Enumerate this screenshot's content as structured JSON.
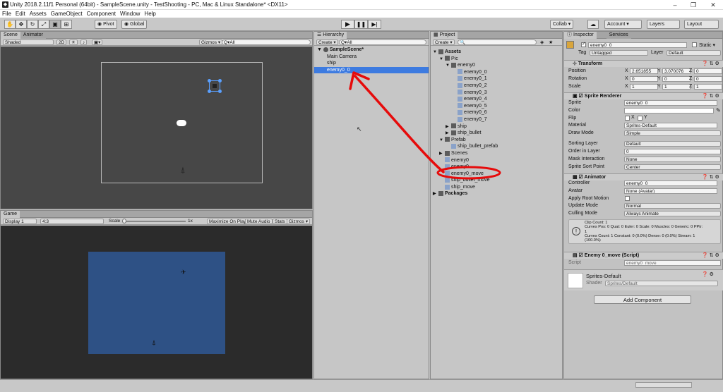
{
  "window": {
    "title": "Unity 2018.2.11f1 Personal (64bit) - SampleScene.unity - TestShooting - PC, Mac & Linux Standalone* <DX11>",
    "controls": [
      "–",
      "❐",
      "✕"
    ]
  },
  "menu": [
    "File",
    "Edit",
    "Assets",
    "GameObject",
    "Component",
    "Window",
    "Help"
  ],
  "toolbar": {
    "pivot": "Pivot",
    "global": "Global",
    "collab": "Collab ▾",
    "account": "Account ▾",
    "layers": "Layers",
    "layout": "Layout"
  },
  "scene": {
    "tab_scene": "Scene",
    "tab_animator": "Animator",
    "shading": "Shaded",
    "mode_2d": "2D",
    "gizmos": "Gizmos ▾",
    "search_placeholder": "Q▾All"
  },
  "game": {
    "tab": "Game",
    "display": "Display 1",
    "aspect": "4:3",
    "scale_label": "Scale",
    "scale_value": "1x",
    "maximize": "Maximize On Play",
    "mute": "Mute Audio",
    "stats": "Stats",
    "gizmos": "Gizmos ▾",
    "bg_color": "#2e5185"
  },
  "hierarchy": {
    "tab": "Hierarchy",
    "create": "Create ▾",
    "search_placeholder": "Q▾All",
    "scene": "SampleScene*",
    "items": [
      "Main Camera",
      "ship",
      "enemy0_0"
    ],
    "selected": "enemy0_0"
  },
  "project": {
    "tab": "Project",
    "create": "Create ▾",
    "tree": [
      {
        "label": "Assets",
        "bold": true,
        "indent": 0,
        "arrow": "▼"
      },
      {
        "label": "Pic",
        "indent": 1,
        "arrow": "▼"
      },
      {
        "label": "enemy0",
        "indent": 2,
        "arrow": "▼"
      },
      {
        "label": "enemy0_0",
        "indent": 3,
        "arrow": ""
      },
      {
        "label": "enemy0_1",
        "indent": 3,
        "arrow": ""
      },
      {
        "label": "enemy0_2",
        "indent": 3,
        "arrow": ""
      },
      {
        "label": "enemy0_3",
        "indent": 3,
        "arrow": ""
      },
      {
        "label": "enemy0_4",
        "indent": 3,
        "arrow": ""
      },
      {
        "label": "enemy0_5",
        "indent": 3,
        "arrow": ""
      },
      {
        "label": "enemy0_6",
        "indent": 3,
        "arrow": ""
      },
      {
        "label": "enemy0_7",
        "indent": 3,
        "arrow": ""
      },
      {
        "label": "ship",
        "indent": 2,
        "arrow": "▶"
      },
      {
        "label": "ship_bullet",
        "indent": 2,
        "arrow": "▶"
      },
      {
        "label": "Prefab",
        "indent": 1,
        "arrow": "▼"
      },
      {
        "label": "ship_bullet_prefab",
        "indent": 2,
        "arrow": ""
      },
      {
        "label": "Scenes",
        "indent": 1,
        "arrow": "▶"
      },
      {
        "label": "enemy0",
        "indent": 1,
        "arrow": ""
      },
      {
        "label": "enemy0",
        "indent": 1,
        "arrow": ""
      },
      {
        "label": "enemy0_move",
        "indent": 1,
        "arrow": ""
      },
      {
        "label": "ship_bullet_move",
        "indent": 1,
        "arrow": ""
      },
      {
        "label": "ship_move",
        "indent": 1,
        "arrow": ""
      },
      {
        "label": "Packages",
        "bold": true,
        "indent": 0,
        "arrow": "▶"
      }
    ]
  },
  "inspector": {
    "tab": "Inspector",
    "tab_services": "Services",
    "object_name": "enemy0_0",
    "static_label": "Static ▾",
    "tag_label": "Tag",
    "tag_value": "Untagged",
    "layer_label": "Layer",
    "layer_value": "Default",
    "transform": {
      "title": "Transform",
      "position_label": "Position",
      "rotation_label": "Rotation",
      "scale_label": "Scale",
      "axis": [
        "X",
        "Y",
        "Z"
      ],
      "position": [
        "2.651855",
        "3.070076",
        "0"
      ],
      "rotation": [
        "0",
        "0",
        "0"
      ],
      "scale": [
        "1",
        "1",
        "1"
      ]
    },
    "sprite_renderer": {
      "title": "Sprite Renderer",
      "labels": [
        "Sprite",
        "Color",
        "Flip",
        "Material",
        "Draw Mode",
        "Sorting Layer",
        "Order in Layer",
        "Mask Interaction",
        "Sprite Sort Point"
      ],
      "sprite": "enemy0_0",
      "flip_x": "X",
      "flip_y": "Y",
      "material": "Sprites-Default",
      "draw_mode": "Simple",
      "sorting_layer": "Default",
      "order_in_layer": "0",
      "mask_interaction": "None",
      "sort_point": "Center"
    },
    "animator": {
      "title": "Animator",
      "labels": [
        "Controller",
        "Avatar",
        "Apply Root Motion",
        "Update Mode",
        "Culling Mode"
      ],
      "controller": "enemy0_0",
      "avatar": "None (Avatar)",
      "update_mode": "Normal",
      "culling_mode": "Always Animate",
      "info_lines": [
        "Clip Count: 1",
        "Curves Pos: 0 Quat: 0 Euler: 0 Scale: 0 Muscles: 0 Generic: 0 PPtr:",
        "1",
        "Curves Count: 1 Constant: 0 (0.0%) Dense: 0 (0.0%) Stream: 1",
        "(100.0%)"
      ]
    },
    "script": {
      "title": "Enemy 0_move (Script)",
      "label": "Script",
      "value": "enemy0_move"
    },
    "material": {
      "name": "Sprites-Default",
      "shader_label": "Shader",
      "shader_value": "Sprites/Default"
    },
    "add_component": "Add Component"
  },
  "colors": {
    "selection": "#3d7be0",
    "annotation": "#e60b0b"
  }
}
